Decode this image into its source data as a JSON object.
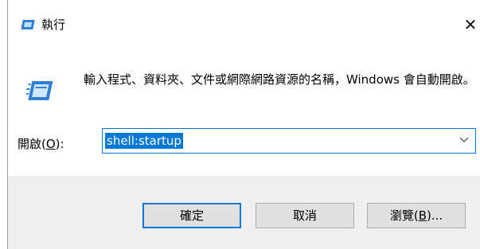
{
  "window": {
    "title": "執行",
    "close_glyph": "✕",
    "title_icon": "run-icon",
    "accent_color": "#0078d7"
  },
  "description": "輸入程式、資料夾、文件或網際網路資源的名稱，Windows 會自動開啟。",
  "open": {
    "label_prefix": "開啟(",
    "label_mnemonic": "O",
    "label_suffix": "):",
    "value": "shell:startup"
  },
  "buttons": {
    "ok": "確定",
    "cancel": "取消",
    "browse_prefix": "瀏覽(",
    "browse_mnemonic": "B",
    "browse_suffix": ")..."
  }
}
